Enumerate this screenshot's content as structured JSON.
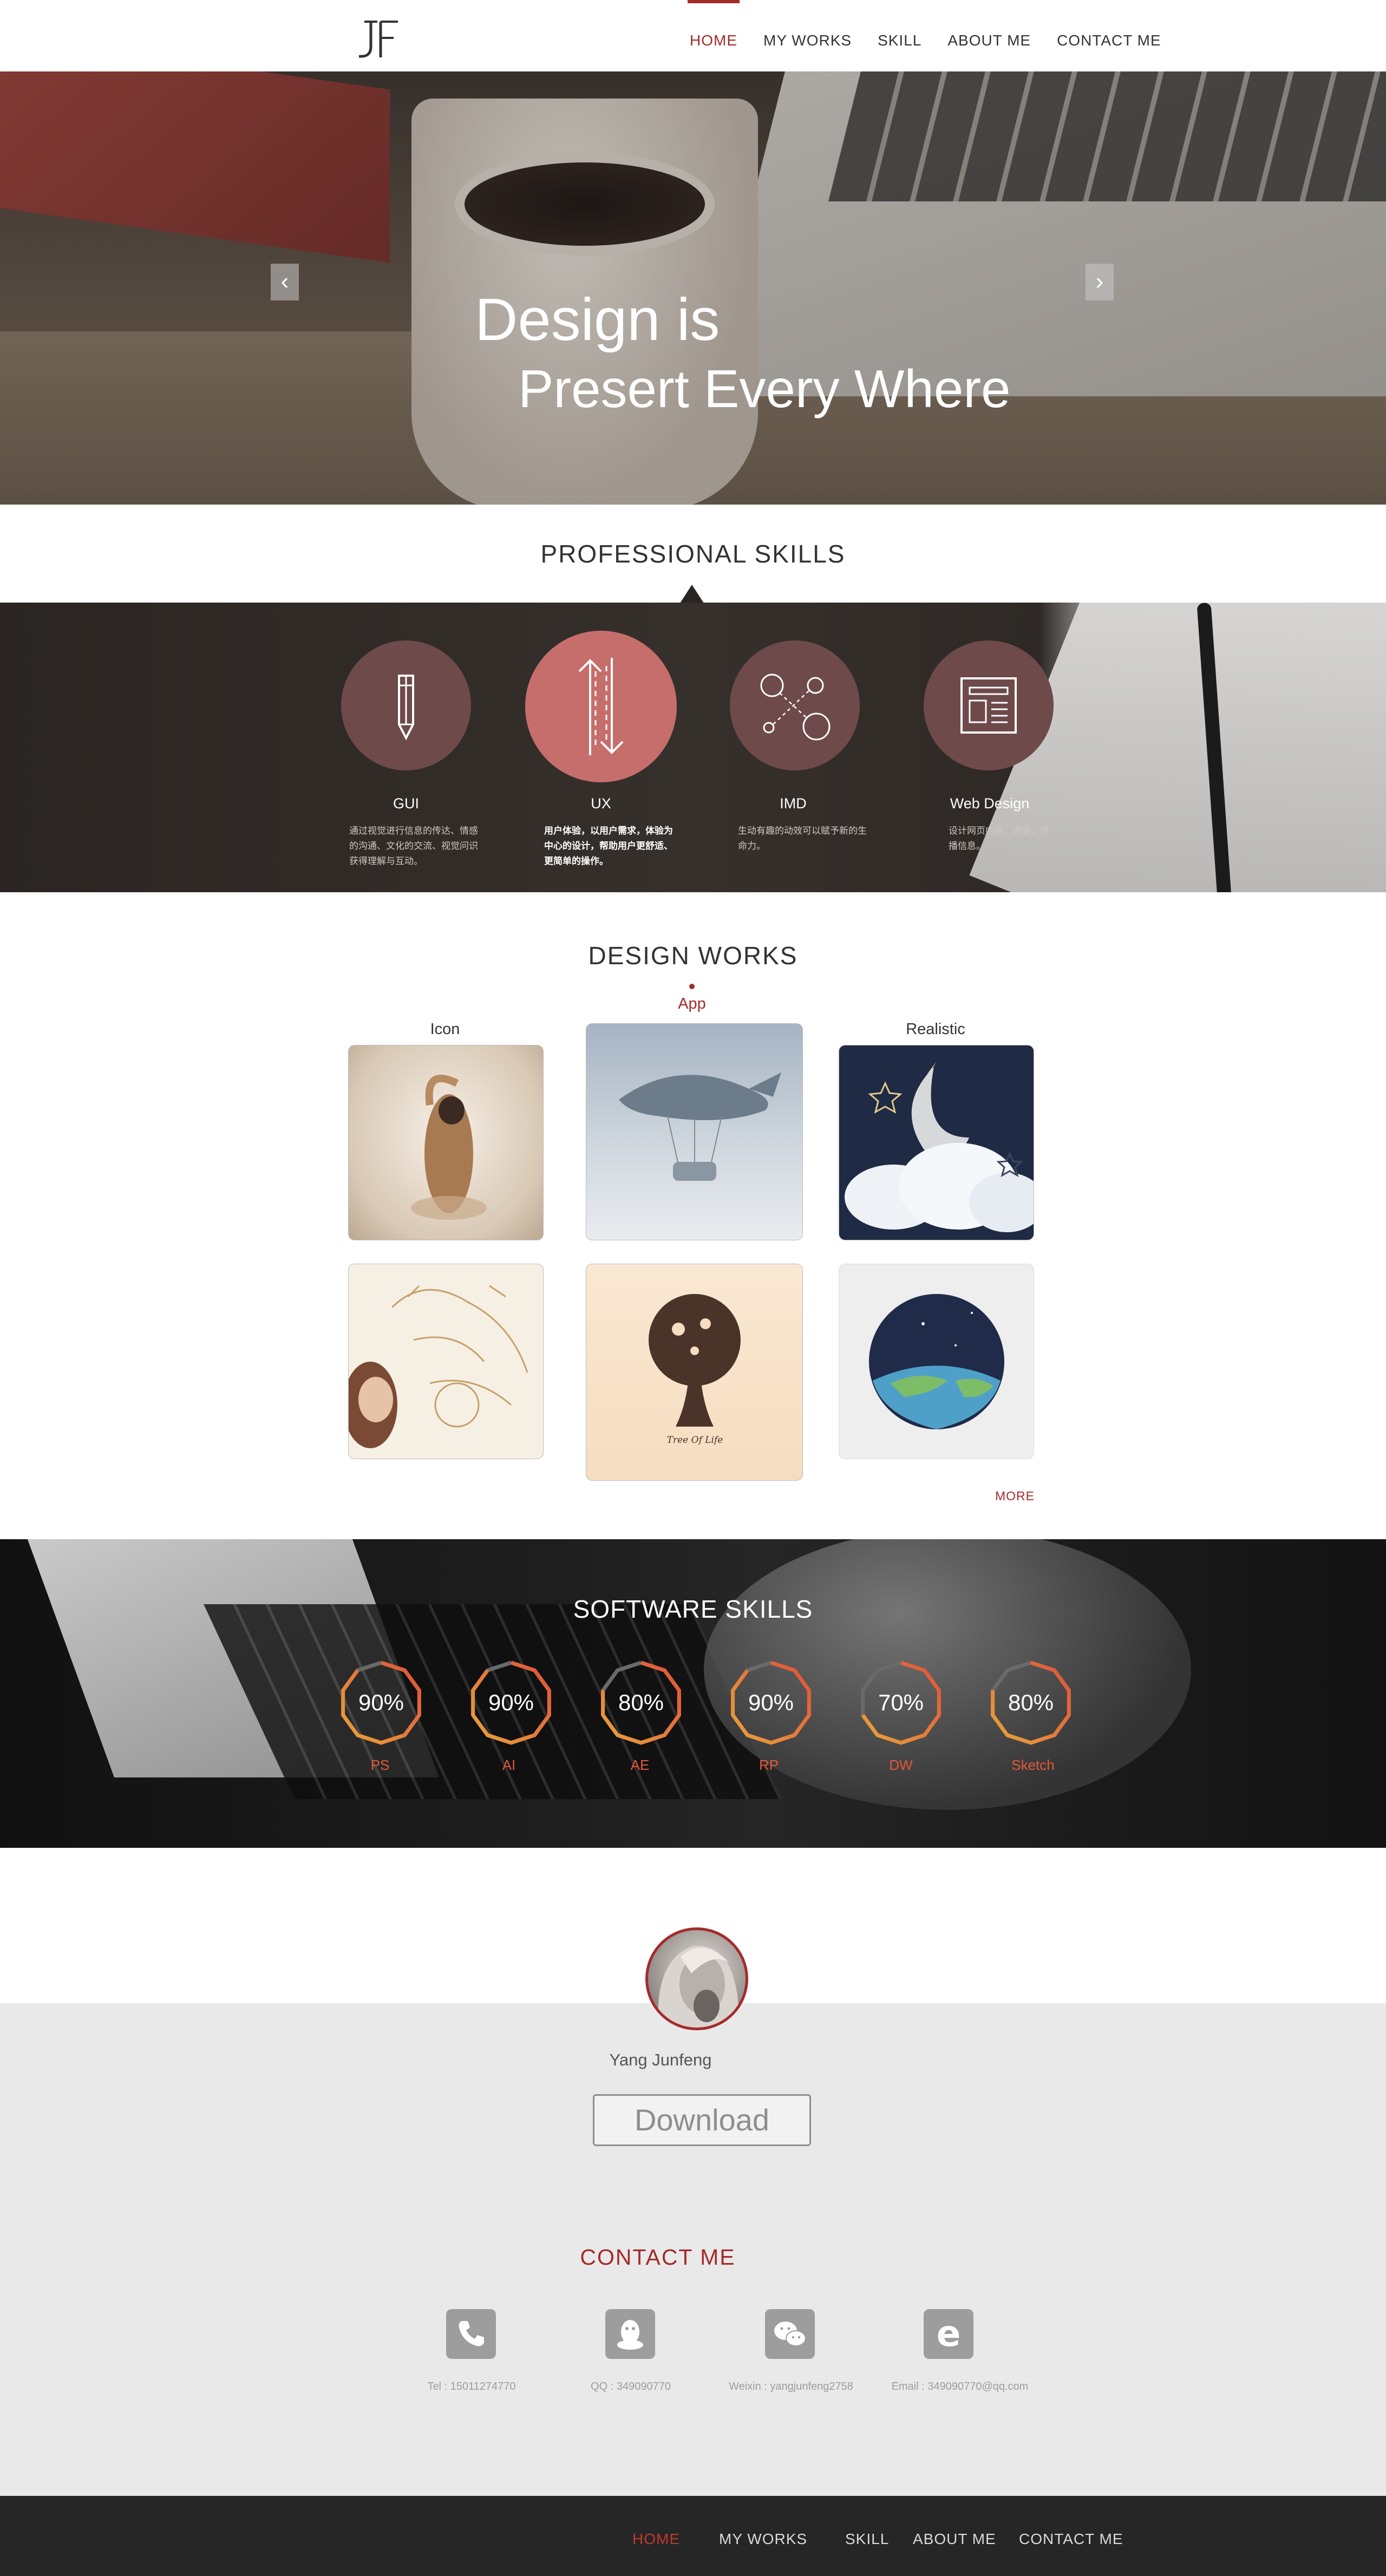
{
  "nav": {
    "logo": "JF",
    "items": [
      {
        "label": "HOME",
        "active": true
      },
      {
        "label": "MY  WORKS",
        "active": false
      },
      {
        "label": "SKILL",
        "active": false
      },
      {
        "label": "ABOUT  ME",
        "active": false
      },
      {
        "label": "CONTACT  ME",
        "active": false
      }
    ]
  },
  "hero": {
    "line1": "Design is",
    "line2": "Presert Every Where",
    "prev_icon": "chevron-left-icon",
    "next_icon": "chevron-right-icon"
  },
  "professional_skills": {
    "title": "PROFESSIONAL SKILLS",
    "items": [
      {
        "name": "GUI",
        "icon": "pencil-icon",
        "desc": "通过视觉进行信息的传达、情感的沟通、文化的交流、视觉问识获得理解与互动。"
      },
      {
        "name": "UX",
        "icon": "up-down-arrows-icon",
        "desc": "用户体验，以用户需求，体验为中心的设计，帮助用户更舒适、更简单的操作。"
      },
      {
        "name": "IMD",
        "icon": "interaction-nodes-icon",
        "desc": "生动有趣的动效可以赋予新的生命力。"
      },
      {
        "name": "Web Design",
        "icon": "webpage-layout-icon",
        "desc": "设计网页内容，内容，传播信息。"
      }
    ]
  },
  "design_works": {
    "title": "DESIGN WORKS",
    "categories": [
      {
        "label": "Icon",
        "active": false
      },
      {
        "label": "App",
        "active": true
      },
      {
        "label": "Realistic",
        "active": false
      }
    ],
    "more": "MORE",
    "tree_caption": "Tree Of Life"
  },
  "software_skills": {
    "title": "SOFTWARE SKILLS",
    "items": [
      {
        "pct": "90%",
        "name": "PS",
        "value": 0.9
      },
      {
        "pct": "90%",
        "name": "AI",
        "value": 0.9
      },
      {
        "pct": "80%",
        "name": "AE",
        "value": 0.8
      },
      {
        "pct": "90%",
        "name": "RP",
        "value": 0.9
      },
      {
        "pct": "70%",
        "name": "DW",
        "value": 0.7
      },
      {
        "pct": "80%",
        "name": "Sketch",
        "value": 0.8
      }
    ],
    "colors": {
      "ring_start": "#e9a33a",
      "ring_end": "#e0503a",
      "ring_dim": "#6a6a6a"
    }
  },
  "profile": {
    "name": "Yang Junfeng",
    "download": "Download"
  },
  "contact": {
    "title": "CONTACT  ME",
    "items": [
      {
        "icon": "phone-icon",
        "text": "Tel : 15011274770"
      },
      {
        "icon": "qq-penguin-icon",
        "text": "QQ : 349090770"
      },
      {
        "icon": "wechat-icon",
        "text": "Weixin : yangjunfeng2758"
      },
      {
        "icon": "email-e-icon",
        "text": "Email : 349090770@qq.com"
      }
    ]
  },
  "footer": {
    "items": [
      {
        "label": "HOME",
        "active": true
      },
      {
        "label": "MY   WORKS",
        "active": false
      },
      {
        "label": "SKILL",
        "active": false
      },
      {
        "label": "ABOUT   ME",
        "active": false
      },
      {
        "label": "CONTACT   ME",
        "active": false
      }
    ]
  },
  "colors": {
    "accent": "#a52a2a",
    "skill_circle": "#6e4a4b",
    "skill_circle_active": "#c66e6c",
    "footer_bg": "#262626",
    "contact_grey": "#e9e9e9"
  }
}
